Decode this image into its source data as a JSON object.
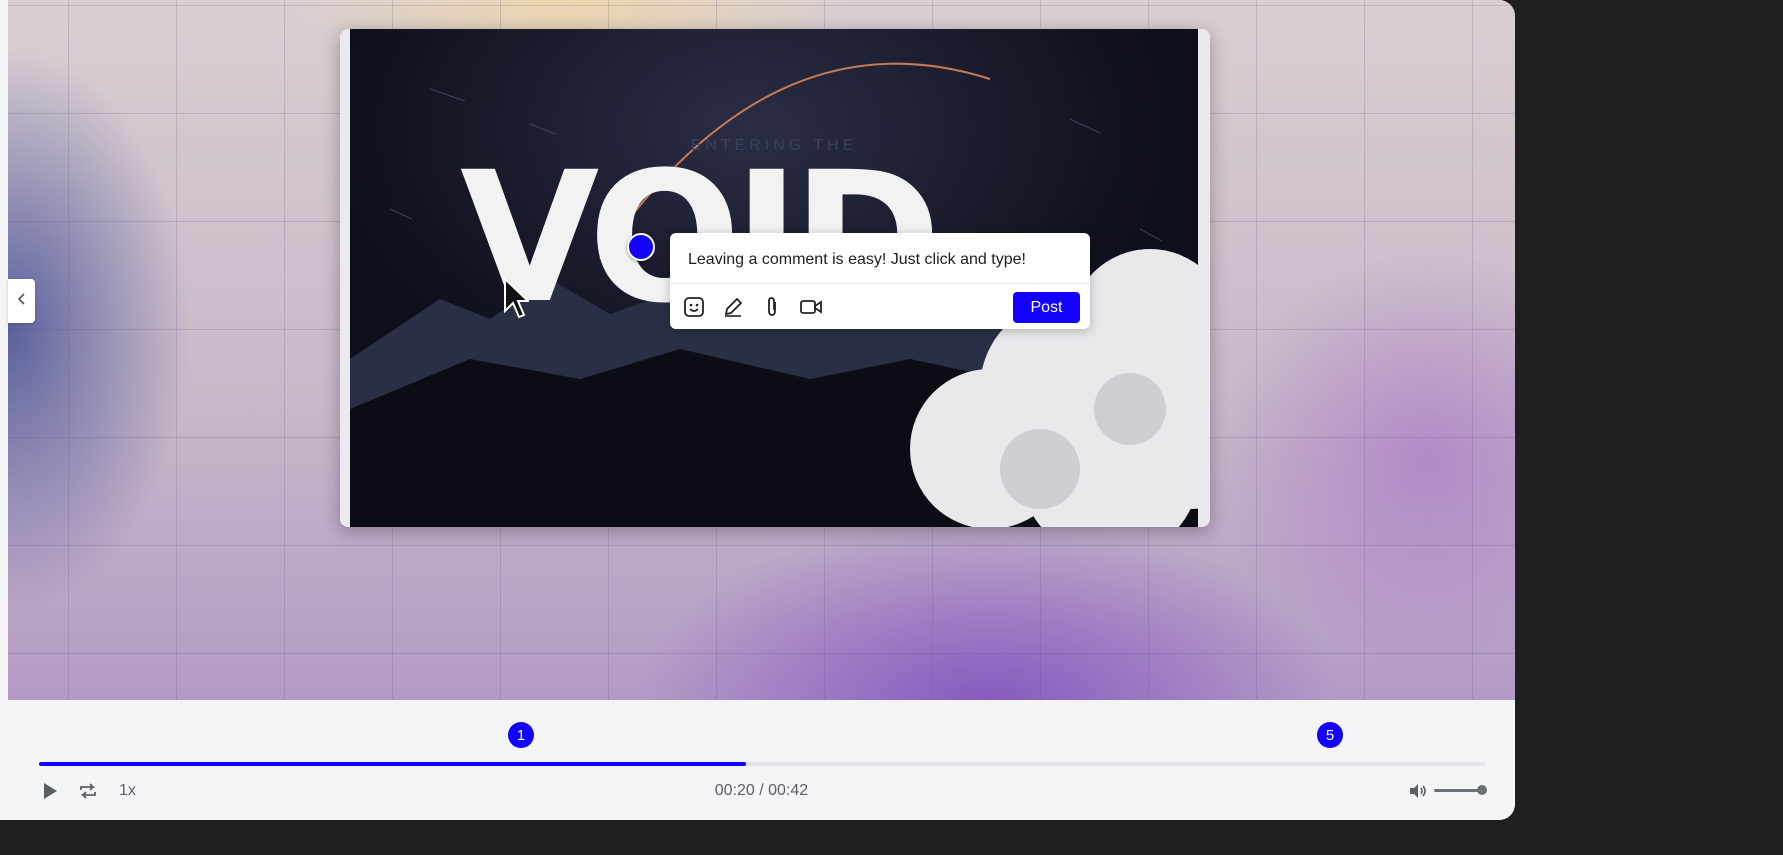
{
  "video": {
    "subtitle": "ENTERING THE",
    "title": "VOID"
  },
  "comment": {
    "text": "Leaving a comment is easy! Just click and type!",
    "post_label": "Post",
    "tools": [
      "emoji-icon",
      "pencil-icon",
      "paperclip-icon",
      "video-camera-icon"
    ]
  },
  "timeline": {
    "markers": [
      {
        "label": "1",
        "time_seconds": 14
      },
      {
        "label": "5",
        "time_seconds": 37.5
      }
    ],
    "progress": 0.4886,
    "speed": "1x",
    "time_display": "00:20 / 00:42",
    "volume": 0.9
  },
  "colors": {
    "accent": "#1400ff",
    "background": "#1f1f1f",
    "controls_bg": "#f4f5f7"
  }
}
